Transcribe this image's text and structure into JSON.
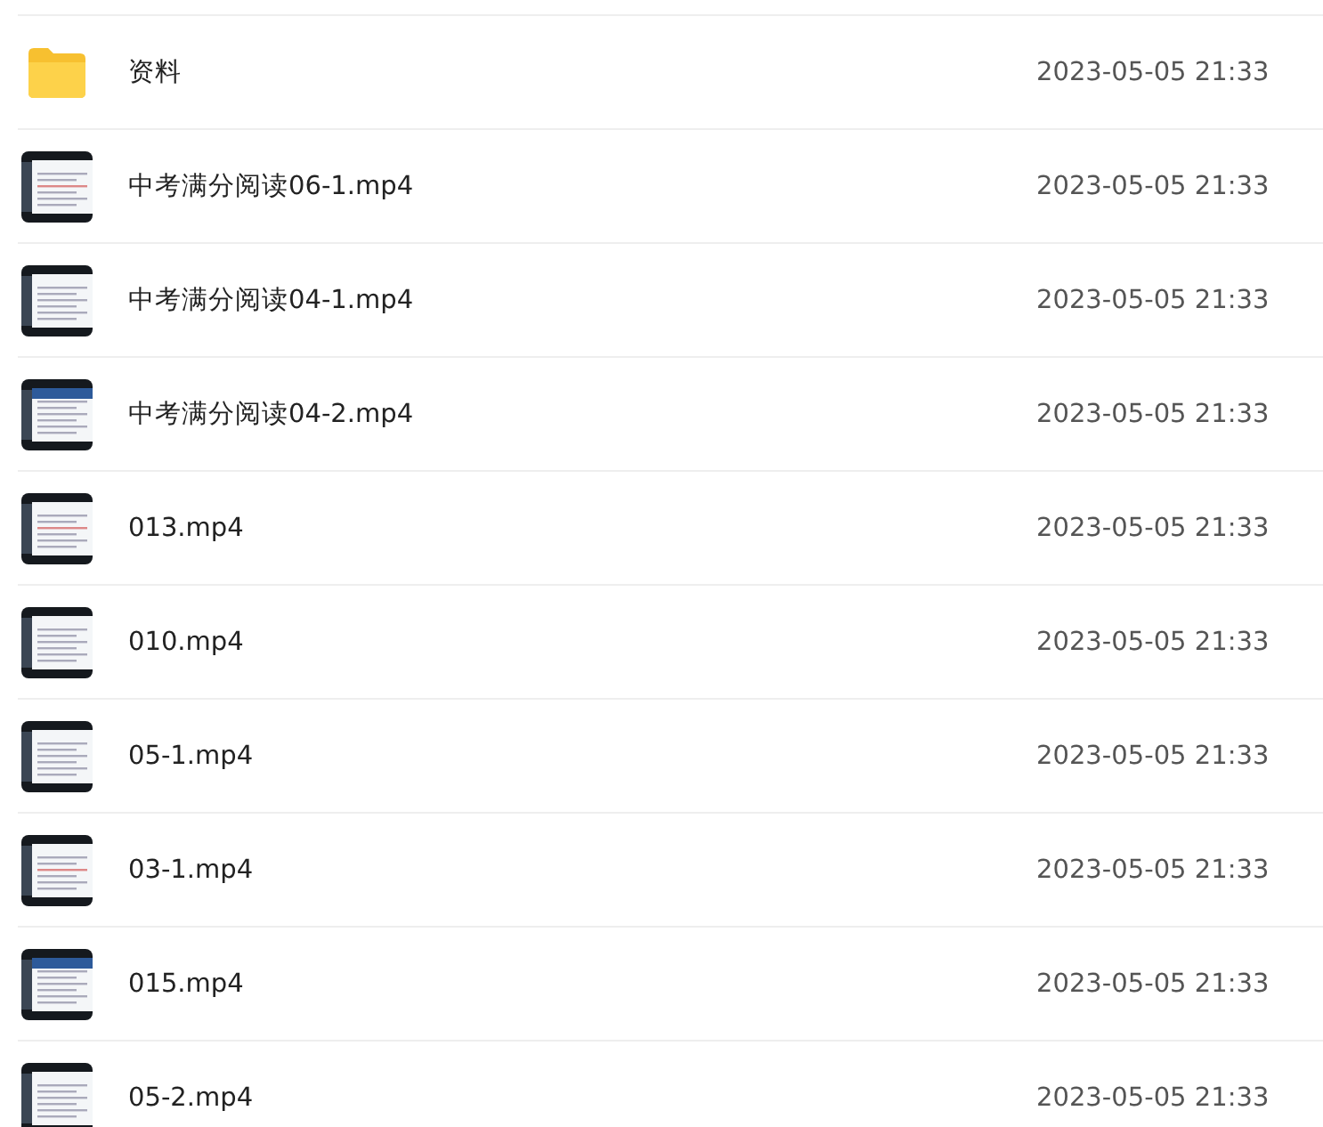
{
  "files": [
    {
      "kind": "folder",
      "name": "资料",
      "modified": "2023-05-05 21:33"
    },
    {
      "kind": "video",
      "name": "中考满分阅读06-1.mp4",
      "modified": "2023-05-05 21:33"
    },
    {
      "kind": "video",
      "name": "中考满分阅读04-1.mp4",
      "modified": "2023-05-05 21:33"
    },
    {
      "kind": "video",
      "name": "中考满分阅读04-2.mp4",
      "modified": "2023-05-05 21:33"
    },
    {
      "kind": "video",
      "name": "013.mp4",
      "modified": "2023-05-05 21:33"
    },
    {
      "kind": "video",
      "name": "010.mp4",
      "modified": "2023-05-05 21:33"
    },
    {
      "kind": "video",
      "name": "05-1.mp4",
      "modified": "2023-05-05 21:33"
    },
    {
      "kind": "video",
      "name": "03-1.mp4",
      "modified": "2023-05-05 21:33"
    },
    {
      "kind": "video",
      "name": "015.mp4",
      "modified": "2023-05-05 21:33"
    },
    {
      "kind": "video",
      "name": "05-2.mp4",
      "modified": "2023-05-05 21:33"
    }
  ]
}
